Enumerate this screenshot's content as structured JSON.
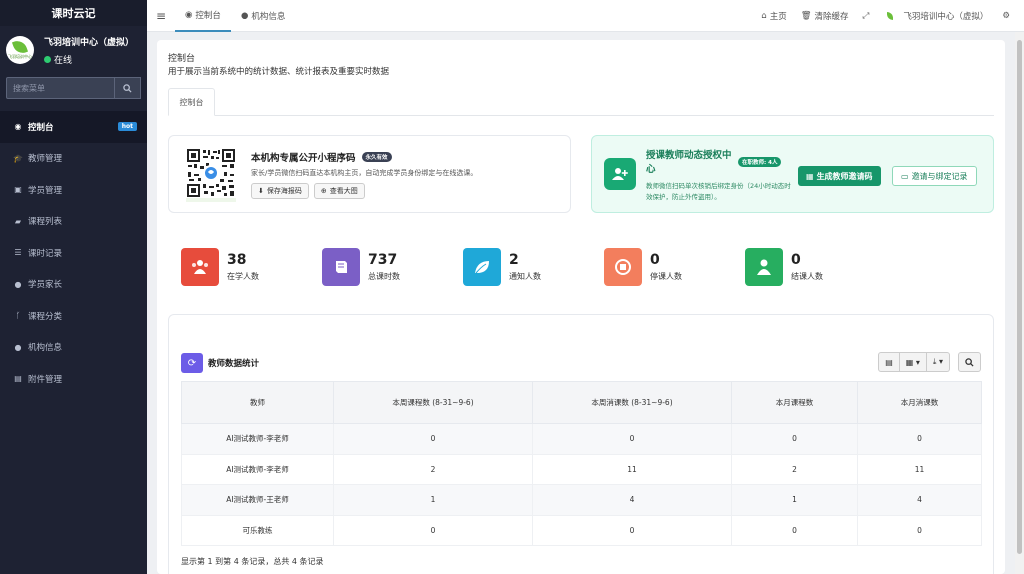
{
  "brand": "课时云记",
  "user": {
    "name": "飞羽培训中心（虚拟）",
    "status": "在线",
    "avatar_text": "飞羽培训中心"
  },
  "search": {
    "placeholder": "搜索菜单"
  },
  "menu": [
    {
      "label": "控制台",
      "icon": "dashboard-icon",
      "badge": "hot",
      "active": true
    },
    {
      "label": "教师管理",
      "icon": "graduation-cap-icon"
    },
    {
      "label": "学员管理",
      "icon": "id-card-icon"
    },
    {
      "label": "课程列表",
      "icon": "book-icon"
    },
    {
      "label": "课时记录",
      "icon": "list-icon"
    },
    {
      "label": "学员家长",
      "icon": "user-icon"
    },
    {
      "label": "课程分类",
      "icon": "branch-icon"
    },
    {
      "label": "机构信息",
      "icon": "user-icon"
    },
    {
      "label": "附件管理",
      "icon": "file-icon"
    }
  ],
  "topbar": {
    "tabs": [
      {
        "label": "控制台",
        "icon": "dashboard-icon",
        "active": true
      },
      {
        "label": "机构信息",
        "icon": "user-icon"
      }
    ],
    "home": "主页",
    "clear_cache": "清除缓存",
    "org_name": "飞羽培训中心（虚拟）"
  },
  "page": {
    "title": "控制台",
    "desc": "用于展示当前系统中的统计数据、统计报表及重要实时数据",
    "subtab": "控制台"
  },
  "qr_card": {
    "title": "本机构专属公开小程序码",
    "badge": "永久有效",
    "desc": "家长/学员微信扫码直达本机构主页，自动完成学员身份绑定与在线选课。",
    "save_btn": "保存海报码",
    "view_btn": "查看大图"
  },
  "auth_card": {
    "title": "授课教师动态授权中心",
    "badge": "在职教师: 4人",
    "desc": "教师微信扫码单次核销后绑定身份（24小时动态时效保护，防止外传盗用）。",
    "generate_btn": "生成教师邀请码",
    "records_btn": "邀请与绑定记录"
  },
  "stats": [
    {
      "value": "38",
      "label": "在学人数",
      "color": "#e74c3c",
      "icon": "users-icon"
    },
    {
      "value": "737",
      "label": "总课时数",
      "color": "#7b5fc6",
      "icon": "book-icon"
    },
    {
      "value": "2",
      "label": "通知人数",
      "color": "#1fa8d8",
      "icon": "leaf-icon"
    },
    {
      "value": "0",
      "label": "停课人数",
      "color": "#f37e5d",
      "icon": "stop-icon"
    },
    {
      "value": "0",
      "label": "结课人数",
      "color": "#27ae60",
      "icon": "user-icon"
    }
  ],
  "teacher_table": {
    "title": "教师数据统计",
    "columns": [
      "教师",
      "本周课程数 (8-31~9-6)",
      "本周消课数 (8-31~9-6)",
      "本月课程数",
      "本月消课数"
    ],
    "rows": [
      [
        "AI测试教师-李老师",
        "0",
        "0",
        "0",
        "0"
      ],
      [
        "AI测试教师-李老师",
        "2",
        "11",
        "2",
        "11"
      ],
      [
        "AI测试教师-王老师",
        "1",
        "4",
        "1",
        "4"
      ],
      [
        "可乐教练",
        "0",
        "0",
        "0",
        "0"
      ]
    ],
    "footer": "显示第 1 到第 4 条记录，总共 4 条记录"
  }
}
